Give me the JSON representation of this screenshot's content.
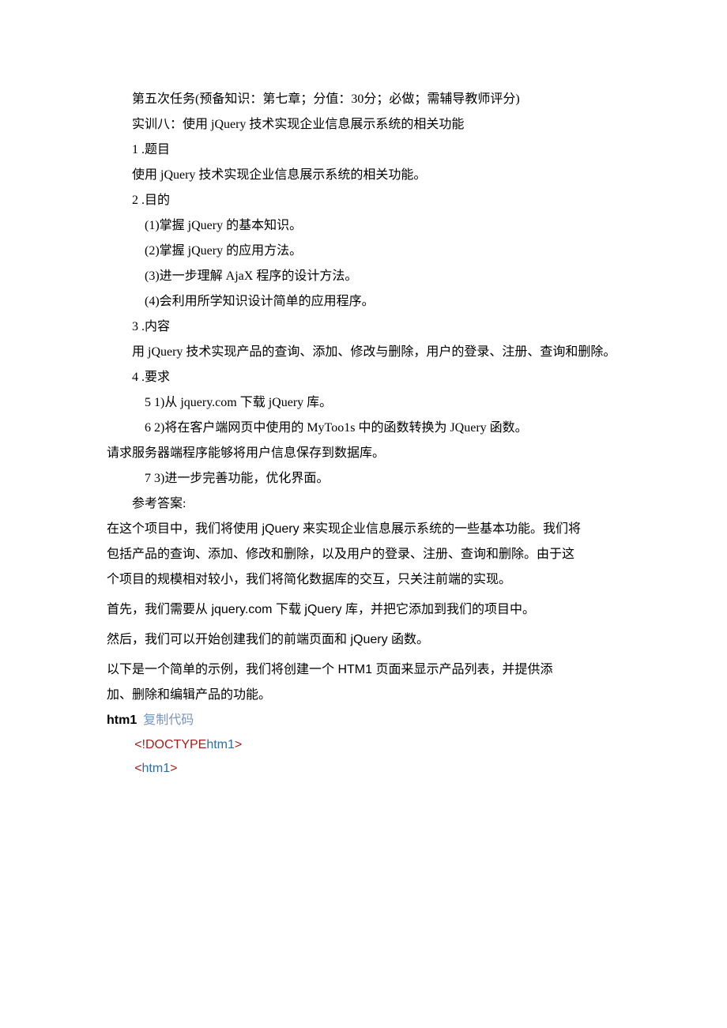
{
  "lines": {
    "l1": "第五次任务(预备知识：第七章；分值：30分；必做；需辅导教师评分)",
    "l2": "实训八：使用 jQuery 技术实现企业信息展示系统的相关功能",
    "l3": "1 .题目",
    "l4": "使用 jQuery 技术实现企业信息展示系统的相关功能。",
    "l5": "2 .目的",
    "l6": "(1)掌握 jQuery 的基本知识。",
    "l7": "(2)掌握 jQuery 的应用方法。",
    "l8": "(3)进一步理解 AjaX 程序的设计方法。",
    "l9": "(4)会利用所学知识设计简单的应用程序。",
    "l10": "3 .内容",
    "l11": "用 jQuery 技术实现产品的查询、添加、修改与删除，用户的登录、注册、查询和删除。",
    "l12": "4 .要求",
    "l13": "5 1)从 jquery.com 下载 jQuery 库。",
    "l14": "6 2)将在客户端网页中使用的 MyToo1s 中的函数转换为 JQuery 函数。",
    "l15": "请求服务器端程序能够将用户信息保存到数据库。",
    "l16": "7 3)进一步完善功能，优化界面。",
    "l17": "参考答案:",
    "a1": "在这个项目中，我们将使用 jQuery 来实现企业信息展示系统的一些基本功能。我们将",
    "a2": "包括产品的查询、添加、修改和删除，以及用户的登录、注册、查询和删除。由于这",
    "a3": "个项目的规模相对较小，我们将简化数据库的交互，只关注前端的实现。",
    "a4": "首先，我们需要从 jquery.com 下载 jQuery 库，并把它添加到我们的项目中。",
    "a5": "然后，我们可以开始创建我们的前端页面和 jQuery 函数。",
    "a6": "以下是一个简单的示例，我们将创建一个 HTM1 页面来显示产品列表，并提供添",
    "a7": "加、删除和编辑产品的功能。"
  },
  "code": {
    "label": "htm1",
    "copy": "复制代码",
    "line1_open": "<!",
    "line1_doctype": "DOCTYPE",
    "line1_html": "htm1",
    "line1_close": ">",
    "line2_open": "<",
    "line2_name": "htm1",
    "line2_close": ">"
  }
}
